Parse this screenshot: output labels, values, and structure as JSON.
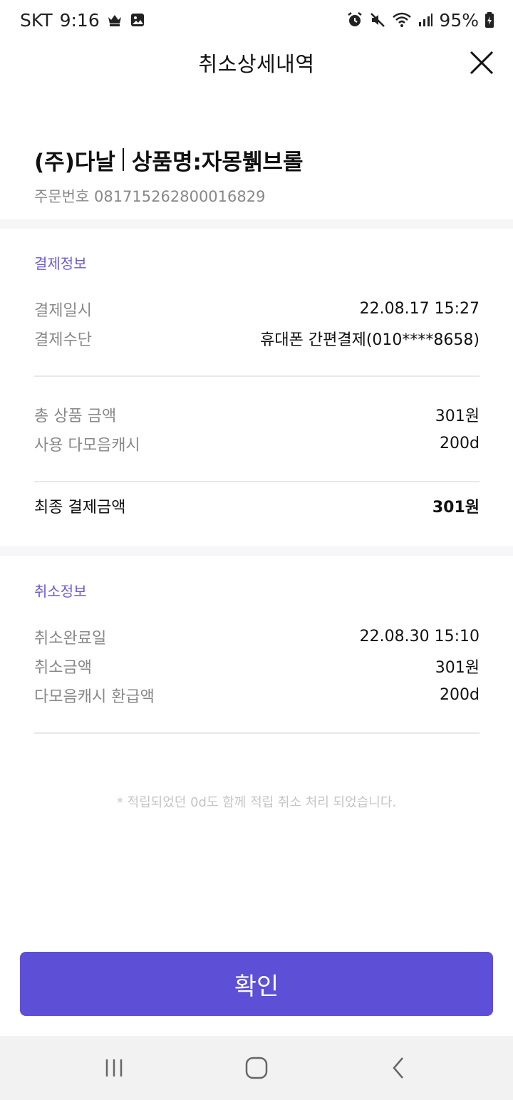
{
  "status_bar": {
    "carrier": "SKT",
    "time": "9:16",
    "battery_percent": "95%",
    "icons": [
      "crown-icon",
      "image-icon",
      "alarm-icon",
      "mute-icon",
      "wifi-icon",
      "signal-icon",
      "battery-charging-icon"
    ]
  },
  "header": {
    "title": "취소상세내역",
    "close_icon": "close-icon"
  },
  "product": {
    "seller": "(주)다날",
    "name": "상품명:자몽뷁브롤",
    "order_label": "주문번호",
    "order_number": "081715262800016829"
  },
  "payment": {
    "section_label": "결제정보",
    "rows": [
      {
        "key": "결제일시",
        "value": "22.08.17 15:27"
      },
      {
        "key": "결제수단",
        "value": "휴대폰 간편결제(010****8658)"
      }
    ],
    "amount_rows": [
      {
        "key": "총 상품 금액",
        "value": "301원"
      },
      {
        "key": "사용 다모음캐시",
        "value": "200d"
      }
    ],
    "final": {
      "key": "최종 결제금액",
      "value": "301원"
    }
  },
  "cancel": {
    "section_label": "취소정보",
    "rows": [
      {
        "key": "취소완료일",
        "value": "22.08.30 15:10"
      },
      {
        "key": "취소금액",
        "value": "301원"
      },
      {
        "key": "다모음캐시 환급액",
        "value": "200d"
      }
    ]
  },
  "notice": "* 적립되었던 0d도 함께 적립 취소 처리 되었습니다.",
  "confirm_label": "확인",
  "colors": {
    "accent": "#5d50d6",
    "section_label": "#6a5bd3",
    "muted_text": "#888888",
    "band": "#f6f6f8",
    "nav_bg": "#f2f2f3"
  },
  "nav_bar": [
    "recent-apps-icon",
    "home-icon",
    "back-icon"
  ]
}
